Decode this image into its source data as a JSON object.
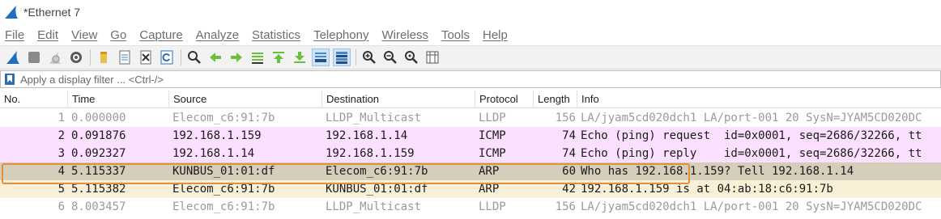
{
  "window": {
    "title": "*Ethernet 7"
  },
  "menu": [
    "File",
    "Edit",
    "View",
    "Go",
    "Capture",
    "Analyze",
    "Statistics",
    "Telephony",
    "Wireless",
    "Tools",
    "Help"
  ],
  "toolbar": {
    "icons": [
      "shark-fin-start-icon",
      "stop-square-icon",
      "restart-fin-icon",
      "options-gear-icon",
      "open-folder-icon",
      "save-file-icon",
      "close-file-icon",
      "reload-icon",
      "find-magnifier-icon",
      "go-back-arrow-icon",
      "go-forward-arrow-icon",
      "go-to-packet-icon",
      "go-first-packet-icon",
      "go-last-packet-icon",
      "autoscroll-icon",
      "colorize-icon",
      "zoom-in-icon",
      "zoom-out-icon",
      "normal-size-icon",
      "resize-columns-icon"
    ]
  },
  "filter": {
    "placeholder": "Apply a display filter ... <Ctrl-/>"
  },
  "columns": [
    "No.",
    "Time",
    "Source",
    "Destination",
    "Protocol",
    "Length",
    "Info"
  ],
  "packets": [
    {
      "no": "1",
      "time": "0.000000",
      "source": "Elecom_c6:91:7b",
      "destination": "LLDP_Multicast",
      "protocol": "LLDP",
      "length": "156",
      "info": "LA/jyam5cd020dch1 LA/port-001 20 SysN=JYAM5CD020DC",
      "bg": "#ffffff",
      "dim": true
    },
    {
      "no": "2",
      "time": "0.091876",
      "source": "192.168.1.159",
      "destination": "192.168.1.14",
      "protocol": "ICMP",
      "length": "74",
      "info": "Echo (ping) request  id=0x0001, seq=2686/32266, tt",
      "bg": "#fce0ff",
      "dim": false
    },
    {
      "no": "3",
      "time": "0.092327",
      "source": "192.168.1.14",
      "destination": "192.168.1.159",
      "protocol": "ICMP",
      "length": "74",
      "info": "Echo (ping) reply    id=0x0001, seq=2686/32266, tt",
      "bg": "#fce0ff",
      "dim": false
    },
    {
      "no": "4",
      "time": "5.115337",
      "source": "KUNBUS_01:01:df",
      "destination": "Elecom_c6:91:7b",
      "protocol": "ARP",
      "length": "60",
      "info": "Who has 192.168.1.159? Tell 192.168.1.14",
      "bg": "#d4ceba",
      "dim": false
    },
    {
      "no": "5",
      "time": "5.115382",
      "source": "Elecom_c6:91:7b",
      "destination": "KUNBUS_01:01:df",
      "protocol": "ARP",
      "length": "42",
      "info": "192.168.1.159 is at 04:ab:18:c6:91:7b",
      "bg": "#faf0d7",
      "dim": false
    },
    {
      "no": "6",
      "time": "8.003457",
      "source": "Elecom_c6:91:7b",
      "destination": "LLDP_Multicast",
      "protocol": "LLDP",
      "length": "156",
      "info": "LA/jyam5cd020dch1 LA/port-001 20 SysN=JYAM5CD020DC",
      "bg": "#ffffff",
      "dim": true
    }
  ],
  "colors": {
    "accent": "#e58f3c",
    "icmp_row": "#fce0ff",
    "arp_request_row": "#d4ceba",
    "arp_reply_row": "#faf0d7"
  }
}
